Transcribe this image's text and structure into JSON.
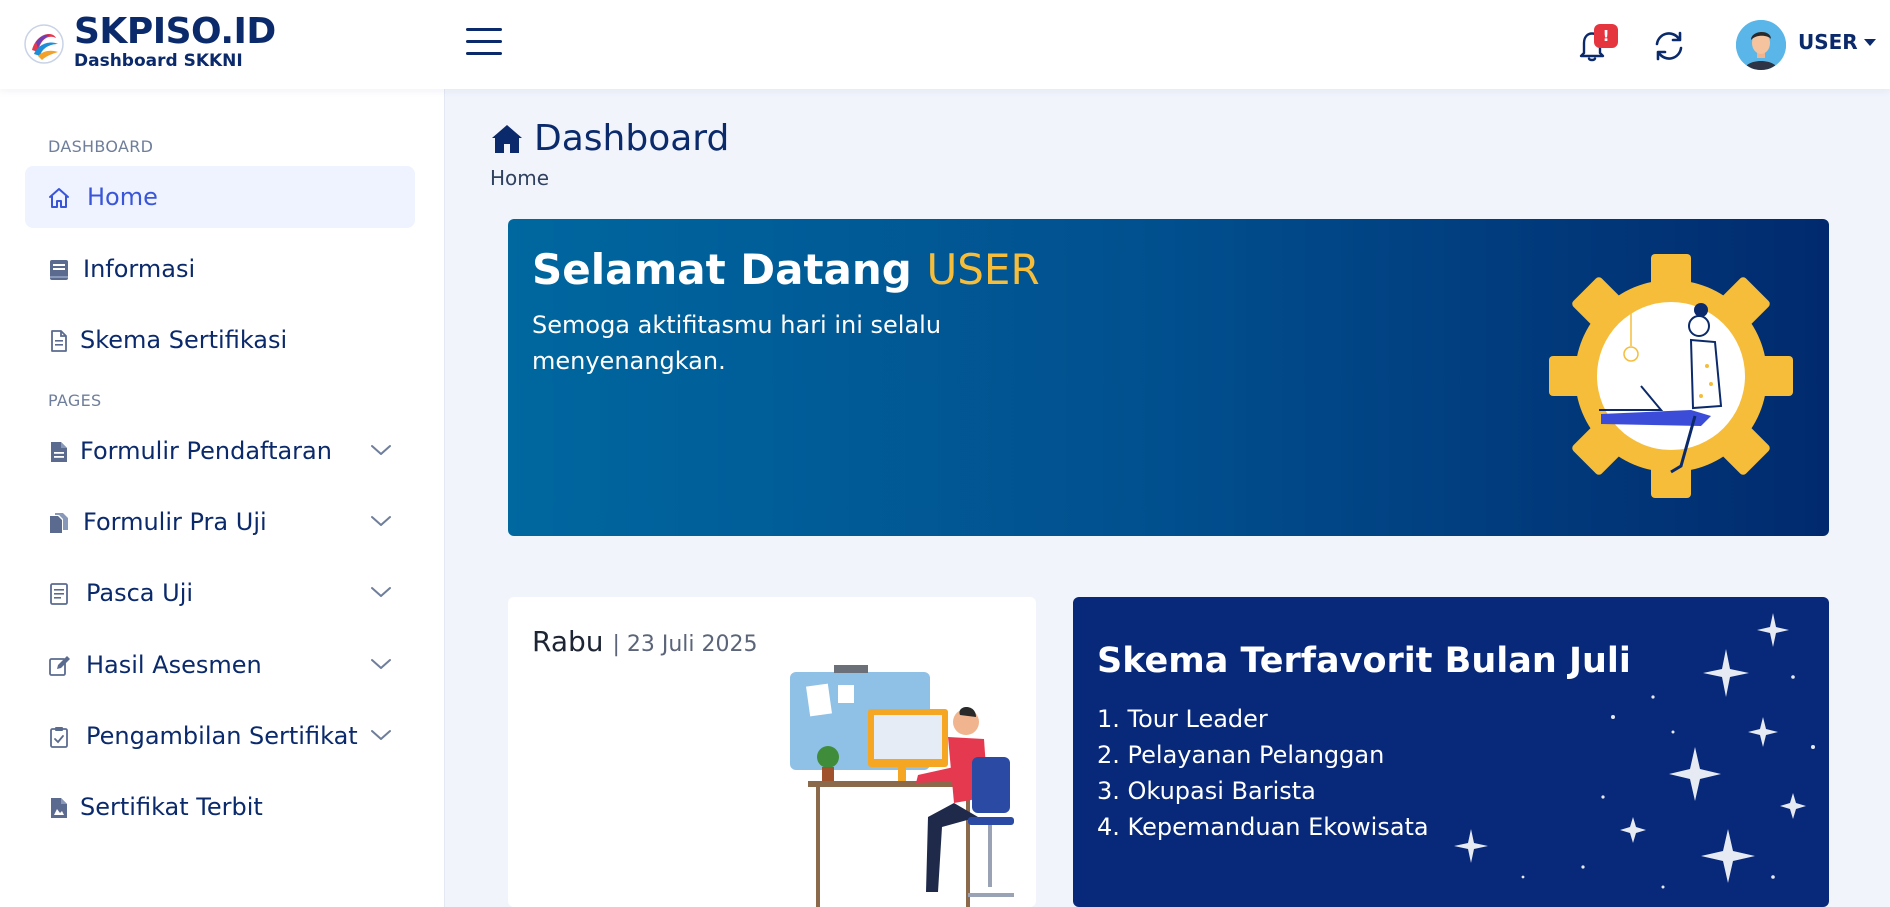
{
  "brand": {
    "title": "SKPISO.ID",
    "subtitle": "Dashboard SKKNI"
  },
  "header": {
    "notification_badge": "!",
    "user_label": "USER"
  },
  "sidebar": {
    "section_dashboard": "DASHBOARD",
    "section_pages": "PAGES",
    "items": [
      {
        "label": "Home",
        "icon": "home-icon",
        "active": true
      },
      {
        "label": "Informasi",
        "icon": "book-icon"
      },
      {
        "label": "Skema Sertifikasi",
        "icon": "document-icon"
      },
      {
        "label": "Formulir Pendaftaran",
        "icon": "file-icon",
        "expandable": true
      },
      {
        "label": "Formulir Pra Uji",
        "icon": "copy-icon",
        "expandable": true
      },
      {
        "label": "Pasca Uji",
        "icon": "list-document-icon",
        "expandable": true
      },
      {
        "label": "Hasil Asesmen",
        "icon": "edit-icon",
        "expandable": true
      },
      {
        "label": "Pengambilan Sertifikat",
        "icon": "clipboard-icon",
        "expandable": true
      },
      {
        "label": "Sertifikat Terbit",
        "icon": "certificate-file-icon"
      }
    ]
  },
  "page": {
    "title": "Dashboard",
    "breadcrumb": "Home"
  },
  "welcome": {
    "greeting": "Selamat Datang",
    "user": "USER",
    "message": "Semoga aktifitasmu hari ini selalu menyenangkan."
  },
  "date_card": {
    "day": "Rabu",
    "date": "| 23 Juli 2025"
  },
  "favorites": {
    "title": "Skema Terfavorit Bulan Juli",
    "items": [
      "1. Tour Leader",
      "2. Pelayanan Pelanggan",
      "3. Okupasi Barista",
      "4. Kepemanduan Ekowisata"
    ]
  },
  "colors": {
    "brand_navy": "#0b2a6b",
    "accent_yellow": "#f6bd3a",
    "active_blue": "#3a56d8",
    "badge_red": "#e5353f"
  }
}
